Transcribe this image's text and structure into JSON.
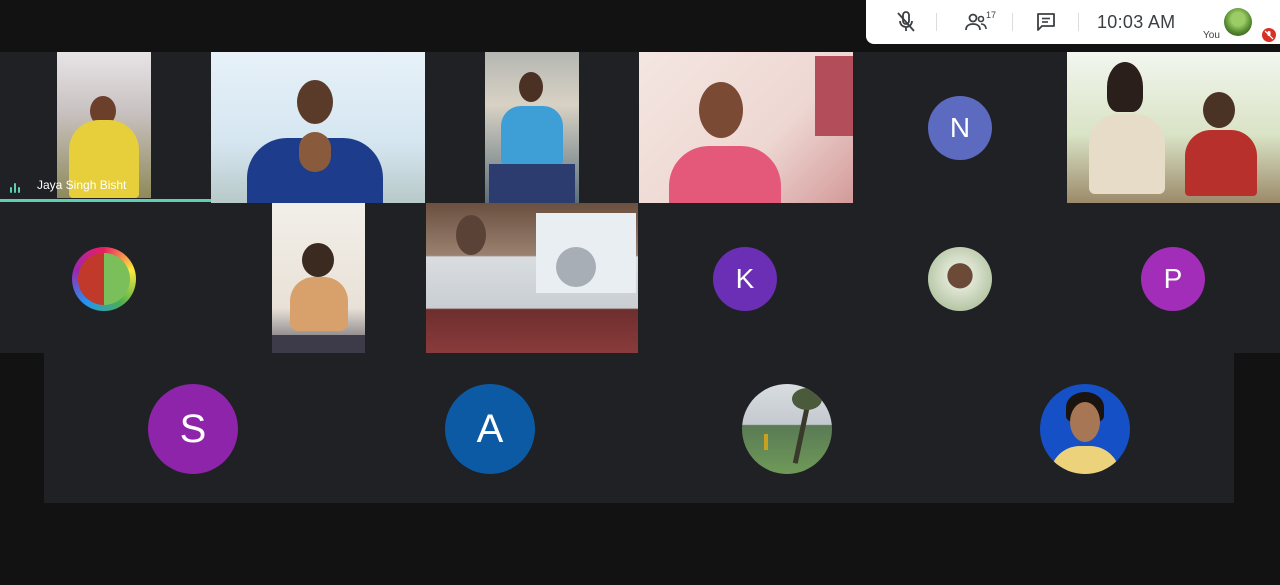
{
  "topbar": {
    "participant_count": "17",
    "time": "10:03  AM",
    "you_label": "You",
    "icons": [
      "mic-off-icon",
      "people-icon",
      "chat-icon"
    ]
  },
  "row1": {
    "tile1": {
      "name": "Jaya Singh Bisht",
      "kind": "video"
    },
    "tile2": {
      "kind": "video"
    },
    "tile3": {
      "kind": "video"
    },
    "tile4": {
      "kind": "video"
    },
    "tile5": {
      "kind": "initial",
      "letter": "N",
      "color": "#5c6bc0"
    },
    "tile6": {
      "kind": "video"
    }
  },
  "row2": {
    "tile1": {
      "kind": "photo"
    },
    "tile2": {
      "kind": "video"
    },
    "tile3": {
      "kind": "video"
    },
    "tile4": {
      "kind": "initial",
      "letter": "K",
      "color": "#6a2fb5"
    },
    "tile5": {
      "kind": "photo"
    },
    "tile6": {
      "kind": "initial",
      "letter": "P",
      "color": "#a22db8"
    }
  },
  "row3": {
    "tile1": {
      "kind": "initial",
      "letter": "S",
      "color": "#8e24aa"
    },
    "tile2": {
      "kind": "initial",
      "letter": "A",
      "color": "#0b5aa3"
    },
    "tile3": {
      "kind": "photo"
    },
    "tile4": {
      "kind": "photo"
    }
  }
}
